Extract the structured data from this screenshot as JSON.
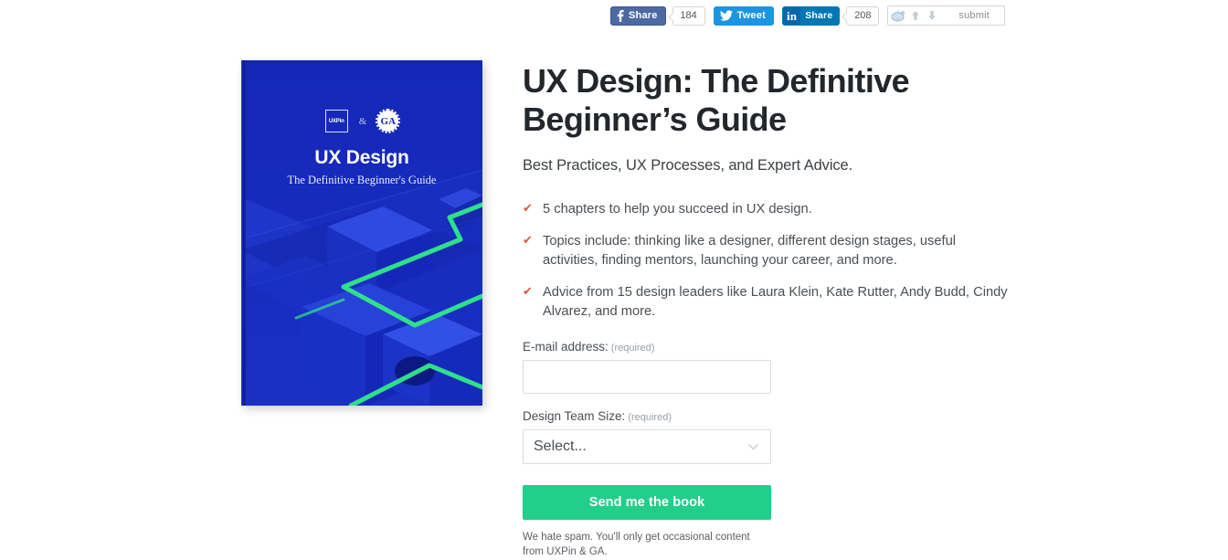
{
  "social": {
    "facebook": {
      "label": "Share",
      "icon": "facebook-f-icon",
      "count": "184",
      "color": "#4e69a2"
    },
    "twitter": {
      "label": "Tweet",
      "icon": "twitter-bird-icon",
      "color": "#1b95e0"
    },
    "linkedin": {
      "mark": "in",
      "label": "Share",
      "icon": "linkedin-in-icon",
      "count": "208",
      "color": "#0077b5"
    },
    "reddit": {
      "icon": "reddit-alien-icon",
      "upvote_icon": "arrow-up-icon",
      "downvote_icon": "arrow-down-icon",
      "label": "submit"
    }
  },
  "book": {
    "logo_left": "UXPin",
    "ampersand": "&",
    "logo_right": "GA",
    "title": "UX Design",
    "subtitle": "The Definitive Beginner's Guide",
    "cover_color": "#1427b8",
    "accent_color": "#2ee08a"
  },
  "main": {
    "headline": "UX Design: The Definitive Beginner’s Guide",
    "subhead": "Best Practices, UX Processes, and Expert Advice.",
    "check_icon": "check-icon",
    "check_color": "#d9573f",
    "benefits": [
      "5 chapters to help you succeed in UX design.",
      "Topics include: thinking like a designer, different design stages, useful activities, finding mentors, launching your career, and more.",
      "Advice from 15 design leaders like Laura Klein, Kate Rutter, Andy Budd, Cindy Alvarez, and more."
    ]
  },
  "form": {
    "email_label": "E-mail address:",
    "email_required": "(required)",
    "email_value": "",
    "email_placeholder": "",
    "team_label": "Design Team Size:",
    "team_required": "(required)",
    "team_selected": "Select...",
    "chevron_icon": "chevron-down-icon",
    "submit_label": "Send me the book",
    "submit_color": "#21ce8a",
    "disclaimer": "We hate spam. You'll only get occasional content from UXPin & GA."
  }
}
